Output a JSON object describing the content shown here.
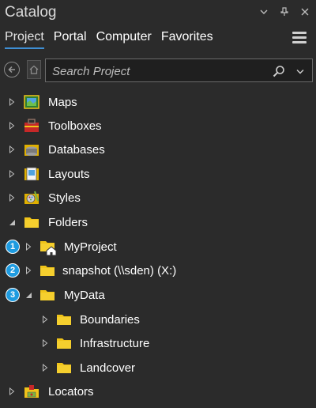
{
  "window": {
    "title": "Catalog"
  },
  "tabs": [
    {
      "label": "Project",
      "active": true
    },
    {
      "label": "Portal",
      "active": false
    },
    {
      "label": "Computer",
      "active": false
    },
    {
      "label": "Favorites",
      "active": false
    }
  ],
  "search": {
    "placeholder": "Search Project"
  },
  "tree": {
    "items": [
      {
        "label": "Maps",
        "expanded": false,
        "icon": "maps-icon"
      },
      {
        "label": "Toolboxes",
        "expanded": false,
        "icon": "toolbox-icon"
      },
      {
        "label": "Databases",
        "expanded": false,
        "icon": "database-icon"
      },
      {
        "label": "Layouts",
        "expanded": false,
        "icon": "layout-icon"
      },
      {
        "label": "Styles",
        "expanded": false,
        "icon": "style-icon"
      },
      {
        "label": "Folders",
        "expanded": true,
        "icon": "folder-icon"
      },
      {
        "label": "MyProject",
        "expanded": false,
        "icon": "home-folder-icon",
        "badge": "1"
      },
      {
        "label": "snapshot (\\\\sden) (X:)",
        "expanded": false,
        "icon": "folder-icon",
        "badge": "2"
      },
      {
        "label": "MyData",
        "expanded": true,
        "icon": "folder-icon",
        "badge": "3"
      },
      {
        "label": "Boundaries",
        "expanded": false,
        "icon": "folder-icon"
      },
      {
        "label": "Infrastructure",
        "expanded": false,
        "icon": "folder-icon"
      },
      {
        "label": "Landcover",
        "expanded": false,
        "icon": "folder-icon"
      },
      {
        "label": "Locators",
        "expanded": false,
        "icon": "locator-icon"
      }
    ]
  },
  "colors": {
    "background": "#2b2b2b",
    "folder": "#f0c419",
    "badge": "#1e9be0",
    "active_tab_underline": "#3f8fd4"
  }
}
